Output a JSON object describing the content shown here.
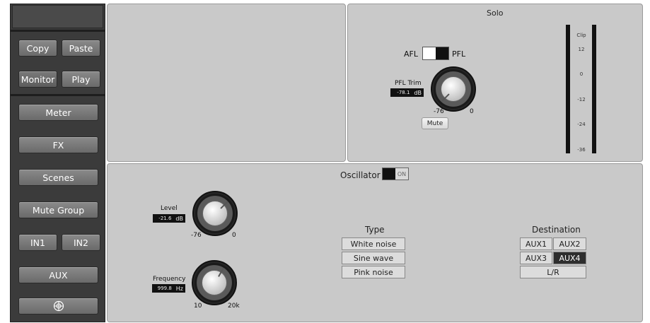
{
  "sidebar": {
    "copy": "Copy",
    "paste": "Paste",
    "monitor": "Monitor",
    "play": "Play",
    "items": [
      "Meter",
      "FX",
      "Scenes",
      "Mute Group"
    ],
    "in1": "IN1",
    "in2": "IN2",
    "aux": "AUX",
    "network_icon": "network-globe-icon"
  },
  "solo": {
    "title": "Solo",
    "afl": "AFL",
    "pfl": "PFL",
    "trim_label": "PFL Trim",
    "trim_value": "-78.1",
    "trim_unit": "dB",
    "knob_min": "-76",
    "knob_max": "0",
    "mute": "Mute",
    "meter_labels": [
      "Clip",
      "12",
      "0",
      "-12",
      "-24",
      "-36"
    ]
  },
  "oscillator": {
    "title": "Oscillator",
    "on_label": "ON",
    "level_label": "Level",
    "level_value": "-21.6",
    "level_unit": "dB",
    "level_min": "-76",
    "level_max": "0",
    "freq_label": "Frequency",
    "freq_value": "999.8",
    "freq_unit": "Hz",
    "freq_min": "10",
    "freq_max": "20k",
    "type_label": "Type",
    "types": [
      "White noise",
      "Sine wave",
      "Pink noise"
    ],
    "dest_label": "Destination",
    "dest": [
      "AUX1",
      "AUX2",
      "AUX3",
      "AUX4",
      "L/R"
    ],
    "dest_selected": "AUX4"
  },
  "colors": {
    "panel": "#c9c9c9",
    "sidebar": "#3b3b3b",
    "selected": "#2e2e2e"
  }
}
